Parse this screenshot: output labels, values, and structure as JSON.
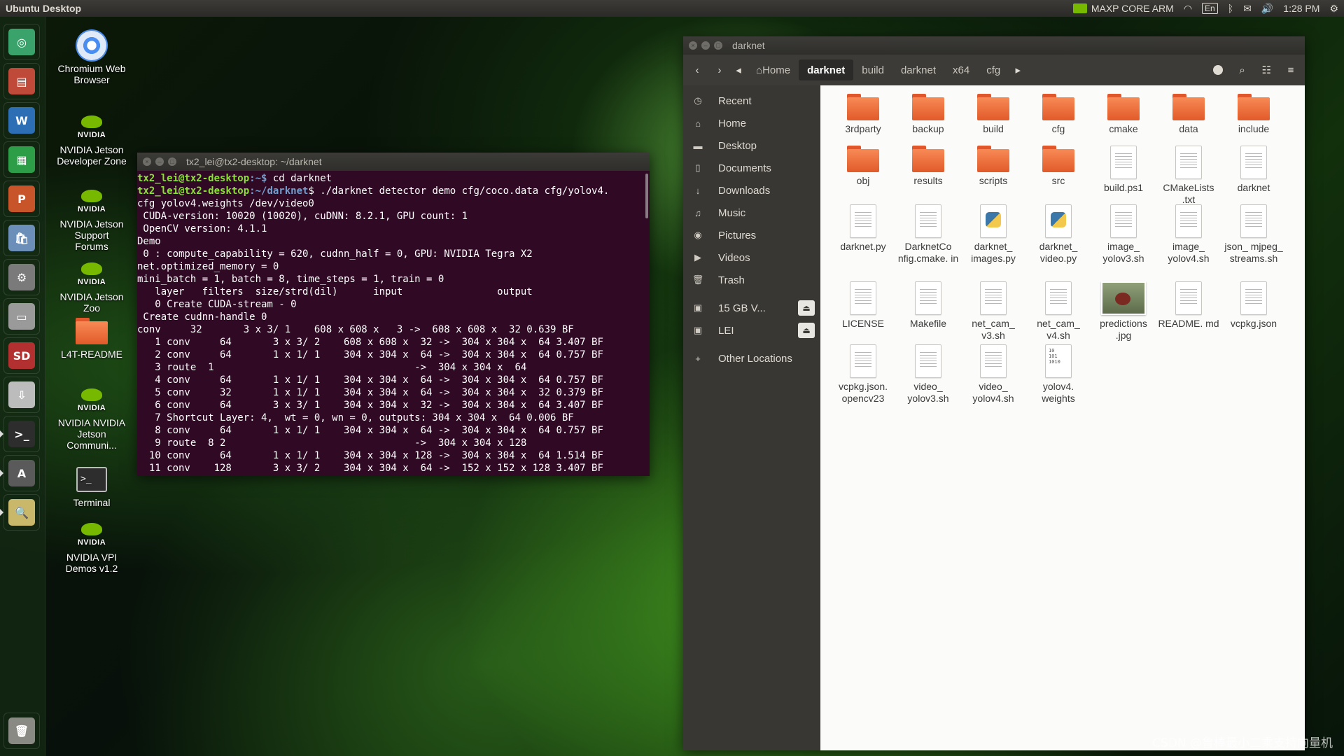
{
  "top_panel": {
    "title": "Ubuntu Desktop",
    "power_mode": "MAXP CORE ARM",
    "keyboard": "En",
    "time": "1:28 PM"
  },
  "launcher": {
    "items": [
      {
        "icon": "ubuntu-dash-icon",
        "color": "#3aa36b",
        "glyph": "◎"
      },
      {
        "icon": "file-cabinet-icon",
        "color": "#c04a3a",
        "glyph": "▤"
      },
      {
        "icon": "libreoffice-writer-icon",
        "color": "#2d6fb5",
        "glyph": "W"
      },
      {
        "icon": "libreoffice-calc-icon",
        "color": "#2e9d47",
        "glyph": "▦"
      },
      {
        "icon": "libreoffice-impress-icon",
        "color": "#c8552a",
        "glyph": "P"
      },
      {
        "icon": "software-center-icon",
        "color": "#6b8fb8",
        "glyph": "🛍"
      },
      {
        "icon": "system-settings-icon",
        "color": "#7a7a7a",
        "glyph": "⚙"
      },
      {
        "icon": "drive-icon",
        "color": "#9a9a9a",
        "glyph": "▭"
      },
      {
        "icon": "sd-card-icon",
        "color": "#b23030",
        "glyph": "SD"
      },
      {
        "icon": "installer-icon",
        "color": "#bcbcbc",
        "glyph": "⇩"
      },
      {
        "icon": "terminal-icon",
        "color": "#2d2d2d",
        "glyph": ">_"
      },
      {
        "icon": "software-updater-icon",
        "color": "#5a5a5a",
        "glyph": "A"
      },
      {
        "icon": "image-viewer-icon",
        "color": "#c9b86a",
        "glyph": "🔍"
      }
    ],
    "trash": {
      "icon": "trash-icon",
      "glyph": "🗑"
    }
  },
  "desktop_icons": [
    {
      "label": "Chromium Web Browser",
      "icon": "chromium-icon"
    },
    {
      "label": "NVIDIA Jetson Developer Zone",
      "icon": "nvidia-icon"
    },
    {
      "label": "NVIDIA Jetson Support Forums",
      "icon": "nvidia-icon"
    },
    {
      "label": "NVIDIA Jetson Zoo",
      "icon": "nvidia-icon"
    },
    {
      "label": "L4T-README",
      "icon": "folder-icon"
    },
    {
      "label": "NVIDIA NVIDIA Jetson Communi...",
      "icon": "nvidia-icon"
    },
    {
      "label": "Terminal",
      "icon": "terminal-icon"
    },
    {
      "label": "NVIDIA VPI Demos v1.2",
      "icon": "nvidia-icon"
    }
  ],
  "terminal": {
    "title": "tx2_lei@tx2-desktop: ~/darknet",
    "prompt1_user": "tx2_lei@tx2-desktop",
    "prompt1_path": ":~$",
    "cmd1": " cd darknet",
    "prompt2_user": "tx2_lei@tx2-desktop",
    "prompt2_path": ":~/darknet",
    "cmd2": "$ ./darknet detector demo cfg/coco.data cfg/yolov4.",
    "lines": [
      "cfg yolov4.weights /dev/video0",
      " CUDA-version: 10020 (10020), cuDNN: 8.2.1, GPU count: 1",
      " OpenCV version: 4.1.1",
      "Demo",
      " 0 : compute_capability = 620, cudnn_half = 0, GPU: NVIDIA Tegra X2",
      "net.optimized_memory = 0",
      "mini_batch = 1, batch = 8, time_steps = 1, train = 0",
      "   layer   filters  size/strd(dil)      input                output",
      "   0 Create CUDA-stream - 0",
      " Create cudnn-handle 0",
      "conv     32       3 x 3/ 1    608 x 608 x   3 ->  608 x 608 x  32 0.639 BF",
      "   1 conv     64       3 x 3/ 2    608 x 608 x  32 ->  304 x 304 x  64 3.407 BF",
      "   2 conv     64       1 x 1/ 1    304 x 304 x  64 ->  304 x 304 x  64 0.757 BF",
      "   3 route  1                                  ->  304 x 304 x  64",
      "   4 conv     64       1 x 1/ 1    304 x 304 x  64 ->  304 x 304 x  64 0.757 BF",
      "   5 conv     32       1 x 1/ 1    304 x 304 x  64 ->  304 x 304 x  32 0.379 BF",
      "   6 conv     64       3 x 3/ 1    304 x 304 x  32 ->  304 x 304 x  64 3.407 BF",
      "   7 Shortcut Layer: 4,  wt = 0, wn = 0, outputs: 304 x 304 x  64 0.006 BF",
      "   8 conv     64       1 x 1/ 1    304 x 304 x  64 ->  304 x 304 x  64 0.757 BF",
      "   9 route  8 2                                ->  304 x 304 x 128",
      "  10 conv     64       1 x 1/ 1    304 x 304 x 128 ->  304 x 304 x  64 1.514 BF",
      "  11 conv    128       3 x 3/ 2    304 x 304 x  64 ->  152 x 152 x 128 3.407 BF"
    ]
  },
  "files": {
    "title": "darknet",
    "breadcrumbs": [
      "Home",
      "darknet",
      "build",
      "darknet",
      "x64",
      "cfg"
    ],
    "sidebar": [
      {
        "label": "Recent",
        "icon": "clock-icon",
        "glyph": "◷"
      },
      {
        "label": "Home",
        "icon": "home-icon",
        "glyph": "⌂"
      },
      {
        "label": "Desktop",
        "icon": "desktop-folder-icon",
        "glyph": "▬"
      },
      {
        "label": "Documents",
        "icon": "document-icon",
        "glyph": "▯"
      },
      {
        "label": "Downloads",
        "icon": "download-icon",
        "glyph": "↓"
      },
      {
        "label": "Music",
        "icon": "music-icon",
        "glyph": "♫"
      },
      {
        "label": "Pictures",
        "icon": "camera-icon",
        "glyph": "◉"
      },
      {
        "label": "Videos",
        "icon": "video-icon",
        "glyph": "▶"
      },
      {
        "label": "Trash",
        "icon": "trash-icon",
        "glyph": "🗑"
      }
    ],
    "devices": [
      {
        "label": "15 GB V...",
        "icon": "drive-icon",
        "glyph": "▣"
      },
      {
        "label": "LEI",
        "icon": "drive-icon",
        "glyph": "▣"
      }
    ],
    "other_locations": "Other Locations",
    "items": [
      {
        "name": "3rdparty",
        "type": "folder"
      },
      {
        "name": "backup",
        "type": "folder"
      },
      {
        "name": "build",
        "type": "folder"
      },
      {
        "name": "cfg",
        "type": "folder"
      },
      {
        "name": "cmake",
        "type": "folder"
      },
      {
        "name": "data",
        "type": "folder"
      },
      {
        "name": "include",
        "type": "folder"
      },
      {
        "name": "obj",
        "type": "folder"
      },
      {
        "name": "results",
        "type": "folder"
      },
      {
        "name": "scripts",
        "type": "folder"
      },
      {
        "name": "src",
        "type": "folder"
      },
      {
        "name": "build.ps1",
        "type": "text"
      },
      {
        "name": "CMakeLists .txt",
        "type": "text"
      },
      {
        "name": "darknet",
        "type": "text"
      },
      {
        "name": "darknet.py",
        "type": "text"
      },
      {
        "name": "DarknetCo nfig.cmake. in",
        "type": "text"
      },
      {
        "name": "darknet_ images.py",
        "type": "python"
      },
      {
        "name": "darknet_ video.py",
        "type": "python"
      },
      {
        "name": "image_ yolov3.sh",
        "type": "text"
      },
      {
        "name": "image_ yolov4.sh",
        "type": "text"
      },
      {
        "name": "json_ mjpeg_ streams.sh",
        "type": "text"
      },
      {
        "name": "LICENSE",
        "type": "text"
      },
      {
        "name": "Makefile",
        "type": "text"
      },
      {
        "name": "net_cam_ v3.sh",
        "type": "text"
      },
      {
        "name": "net_cam_ v4.sh",
        "type": "text"
      },
      {
        "name": "predictions .jpg",
        "type": "image"
      },
      {
        "name": "README. md",
        "type": "text"
      },
      {
        "name": "vcpkg.json",
        "type": "text"
      },
      {
        "name": "vcpkg.json. opencv23",
        "type": "text"
      },
      {
        "name": "video_ yolov3.sh",
        "type": "text"
      },
      {
        "name": "video_ yolov4.sh",
        "type": "text"
      },
      {
        "name": "yolov4. weights",
        "type": "binary"
      }
    ]
  },
  "watermark": "CSDN @鲁棒最小二乘支持向量机"
}
